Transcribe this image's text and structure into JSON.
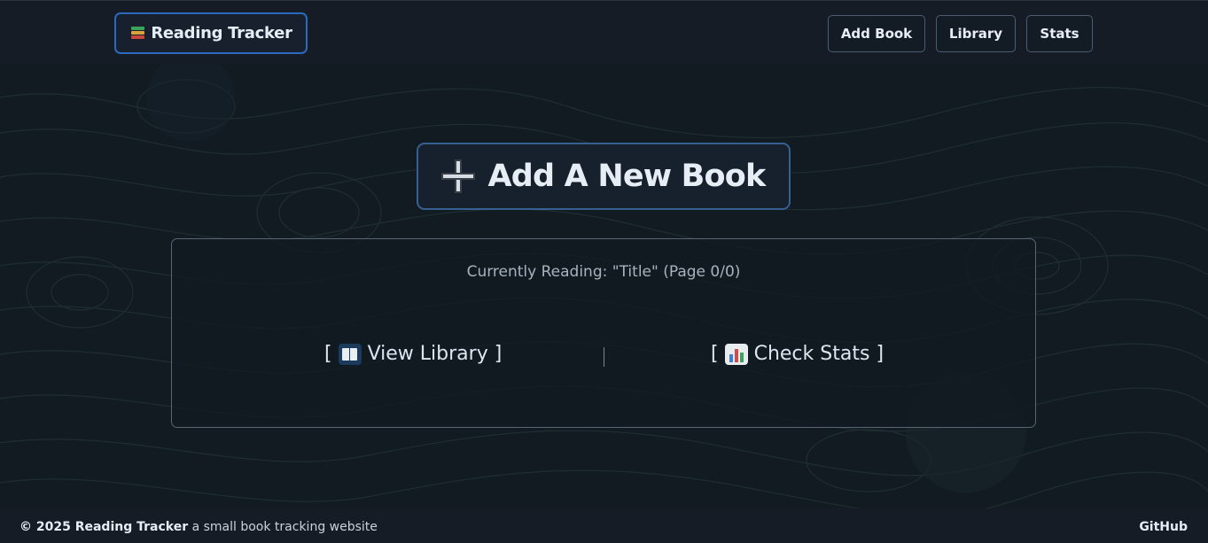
{
  "header": {
    "brand": "Reading Tracker",
    "nav": [
      "Add Book",
      "Library",
      "Stats"
    ]
  },
  "main": {
    "add_button": "Add A New Book",
    "current_reading": "Currently Reading: \"Title\" (Page 0/0)",
    "view_library": {
      "open": "[",
      "label": "View Library",
      "close": "]"
    },
    "check_stats": {
      "open": "[",
      "label": "Check Stats",
      "close": "]"
    }
  },
  "footer": {
    "copyright": "© 2025 Reading Tracker",
    "tagline": "a small book tracking website",
    "link": "GitHub"
  },
  "colors": {
    "background": "#121a22",
    "header": "#151c26",
    "brand_border": "#2a6bbf",
    "button_border": "#35608f"
  },
  "icons": [
    "books-icon",
    "plus-icon",
    "open-book-icon",
    "bar-chart-icon"
  ]
}
